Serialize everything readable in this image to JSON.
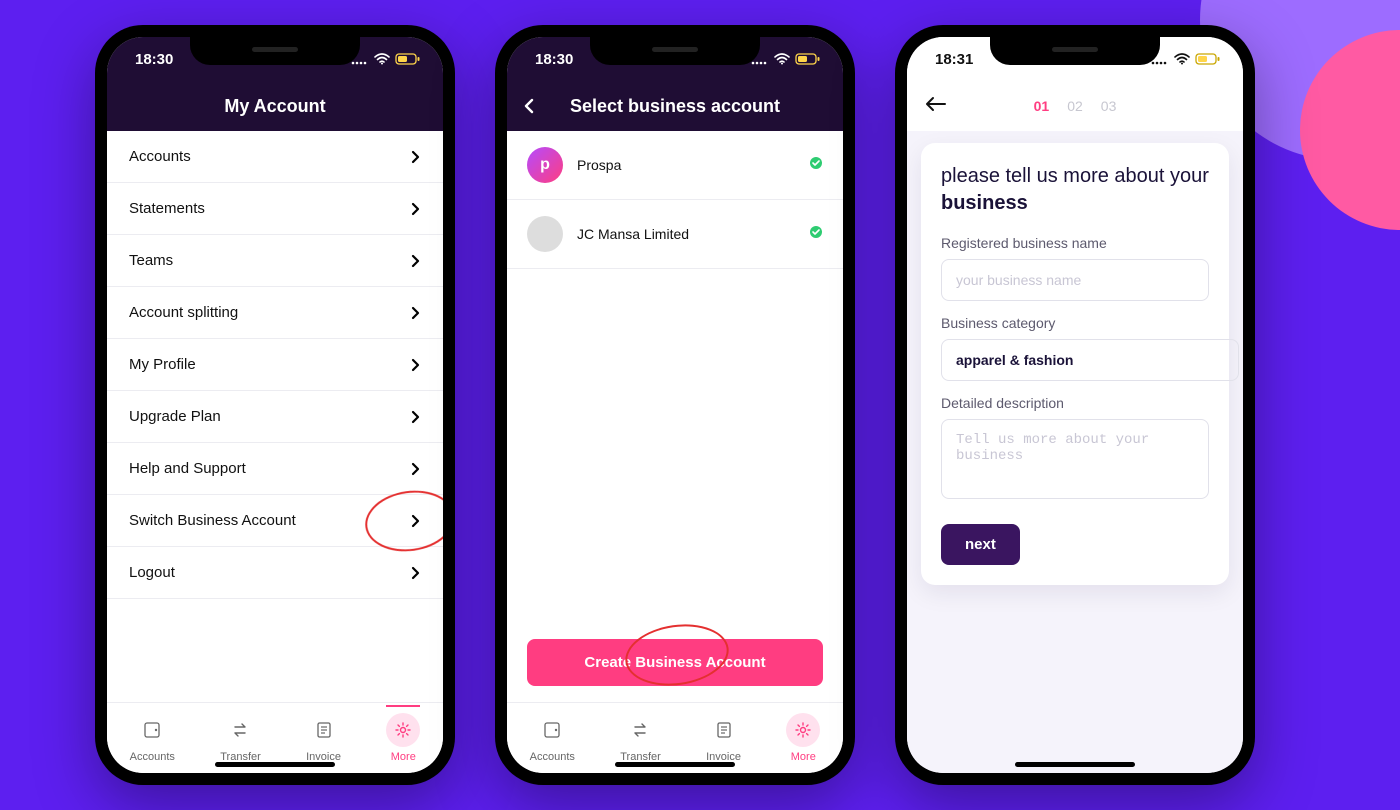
{
  "status": {
    "time1": "18:30",
    "time2": "18:30",
    "time3": "18:31"
  },
  "screen1": {
    "title": "My Account",
    "menu": [
      {
        "label": "Accounts"
      },
      {
        "label": "Statements"
      },
      {
        "label": "Teams"
      },
      {
        "label": "Account splitting"
      },
      {
        "label": "My Profile"
      },
      {
        "label": "Upgrade Plan"
      },
      {
        "label": "Help and Support"
      },
      {
        "label": "Switch Business Account"
      },
      {
        "label": "Logout"
      }
    ]
  },
  "tabs": [
    {
      "label": "Accounts"
    },
    {
      "label": "Transfer"
    },
    {
      "label": "Invoice"
    },
    {
      "label": "More"
    }
  ],
  "screen2": {
    "title": "Select business account",
    "accounts": [
      {
        "name": "Prospa"
      },
      {
        "name": "JC Mansa Limited"
      }
    ],
    "cta": "Create Business Account"
  },
  "screen3": {
    "steps": [
      "01",
      "02",
      "03"
    ],
    "title_line1": "please tell us more about your",
    "title_bold": "business",
    "fields": {
      "name_label": "Registered business name",
      "name_placeholder": "your business name",
      "category_label": "Business category",
      "category_value": "apparel & fashion",
      "desc_label": "Detailed description",
      "desc_placeholder": "Tell us more about your business"
    },
    "next": "next"
  },
  "colors": {
    "accent": "#ff3d81",
    "brand_dark": "#1f0d34",
    "bg": "#5d1ff0"
  }
}
